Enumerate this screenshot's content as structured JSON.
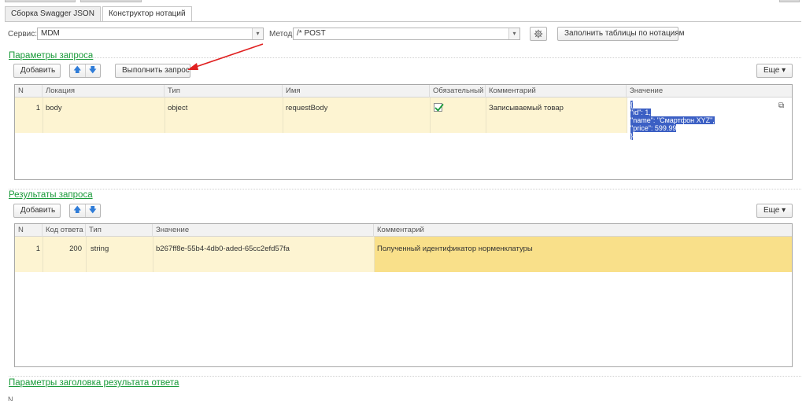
{
  "tabs": [
    {
      "label": "Сборка Swagger JSON",
      "active": false
    },
    {
      "label": "Конструктор нотаций",
      "active": true
    }
  ],
  "service": {
    "label": "Сервис:",
    "value": "MDM"
  },
  "method": {
    "label": "Метод:",
    "value": "/* POST"
  },
  "toolbar": {
    "fill_tables_label": "Заполнить таблицы по нотациям",
    "settings_icon": "gear-icon"
  },
  "request_params": {
    "title": "Параметры запроса",
    "add_label": "Добавить",
    "execute_label": "Выполнить запрос",
    "more_label": "Еще ▾",
    "columns": [
      "N",
      "Локация",
      "Тип",
      "Имя",
      "Обязательный",
      "Комментарий",
      "Значение"
    ],
    "rows": [
      {
        "n": "1",
        "location": "body",
        "type": "object",
        "name": "requestBody",
        "required": true,
        "comment": "Записываемый товар",
        "value_lines": [
          "{",
          "\"id\": 1,",
          "\"name\": \"Смартфон XYZ\",",
          "\"price\": 599.99",
          "}"
        ]
      }
    ]
  },
  "results": {
    "title": "Результаты запроса",
    "add_label": "Добавить",
    "more_label": "Еще ▾",
    "columns": [
      "N",
      "Код ответа",
      "Тип",
      "Значение",
      "Комментарий"
    ],
    "rows": [
      {
        "n": "1",
        "code": "200",
        "type": "string",
        "value": "b267ff8e-55b4-4db0-aded-65cc2efd57fa",
        "comment": "Полученный идентификатор норменклатуры"
      }
    ]
  },
  "header_params": {
    "title": "Параметры заголовка результата ответа",
    "first_col": "N"
  },
  "colors": {
    "accent_green": "#1a9a3a",
    "row_highlight": "#fdf4d2",
    "selected_cell": "#f9e08a",
    "selection_blue": "#3b5fc4",
    "annotation_arrow": "#e02020"
  }
}
